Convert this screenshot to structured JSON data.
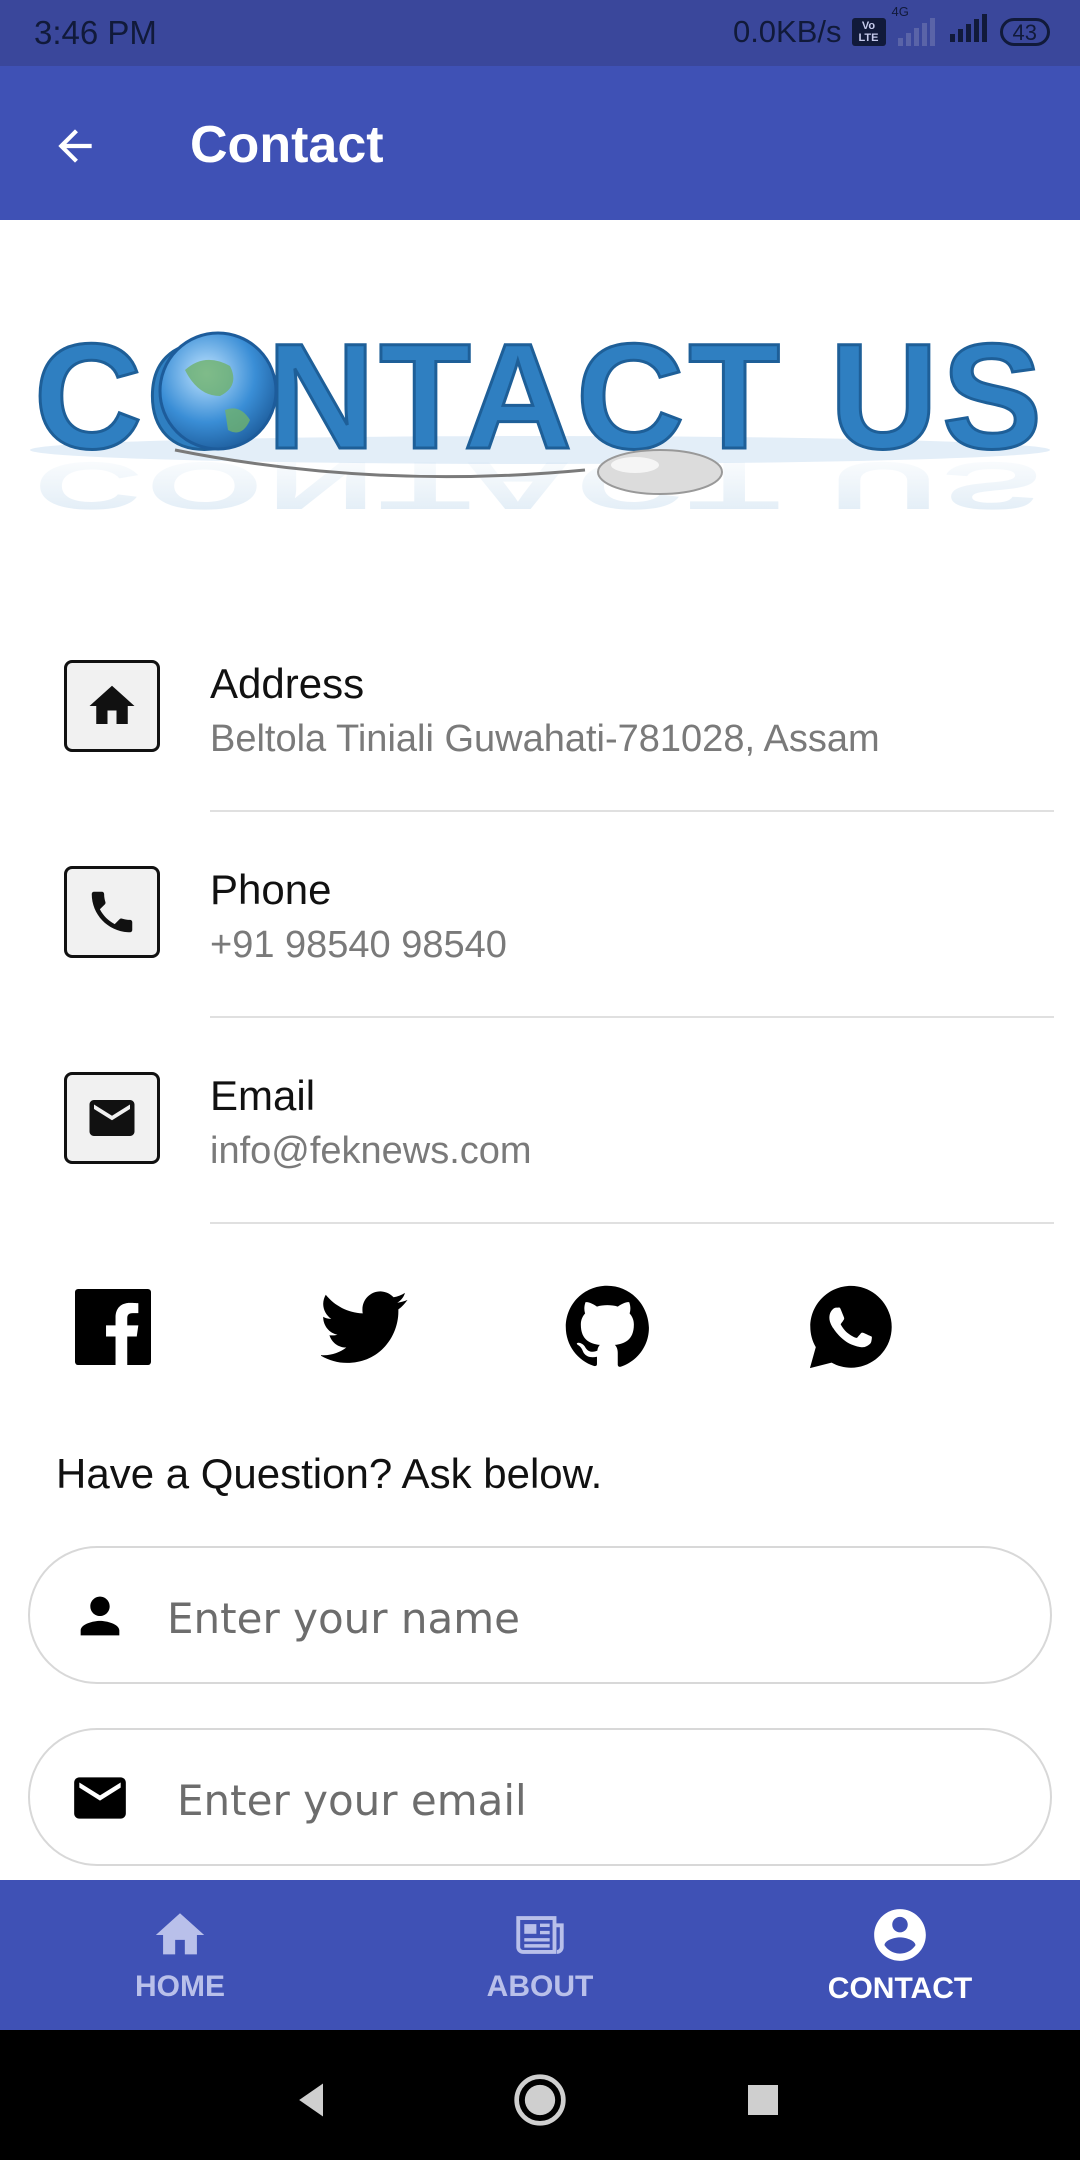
{
  "status_bar": {
    "time": "3:46 PM",
    "speed": "0.0KB/s",
    "volte": "Vo LTE",
    "network": "4G",
    "battery": "43"
  },
  "app_bar": {
    "title": "Contact",
    "back_icon": "arrow-back-icon"
  },
  "banner": {
    "text": "CONTACT US",
    "alt_icons": [
      "globe-icon",
      "mouse-icon"
    ]
  },
  "contacts": [
    {
      "label": "Address",
      "value": "Beltola Tiniali Guwahati-781028, Assam",
      "icon": "home-icon"
    },
    {
      "label": "Phone",
      "value": "+91 98540 98540",
      "icon": "phone-icon"
    },
    {
      "label": "Email",
      "value": "info@feknews.com",
      "icon": "mail-icon"
    }
  ],
  "social": [
    "facebook-icon",
    "twitter-icon",
    "github-icon",
    "whatsapp-icon"
  ],
  "form": {
    "heading": "Have a Question? Ask below.",
    "name_placeholder": "Enter your name",
    "email_placeholder": "Enter your email"
  },
  "bottom_nav": [
    {
      "label": "HOME",
      "icon": "home-icon",
      "active": false
    },
    {
      "label": "ABOUT",
      "icon": "newspaper-icon",
      "active": false
    },
    {
      "label": "CONTACT",
      "icon": "account-circle-icon",
      "active": true
    }
  ],
  "colors": {
    "primary": "#3f51b5",
    "status_bar": "#3a479b",
    "banner_blue": "#2f7fc1"
  }
}
